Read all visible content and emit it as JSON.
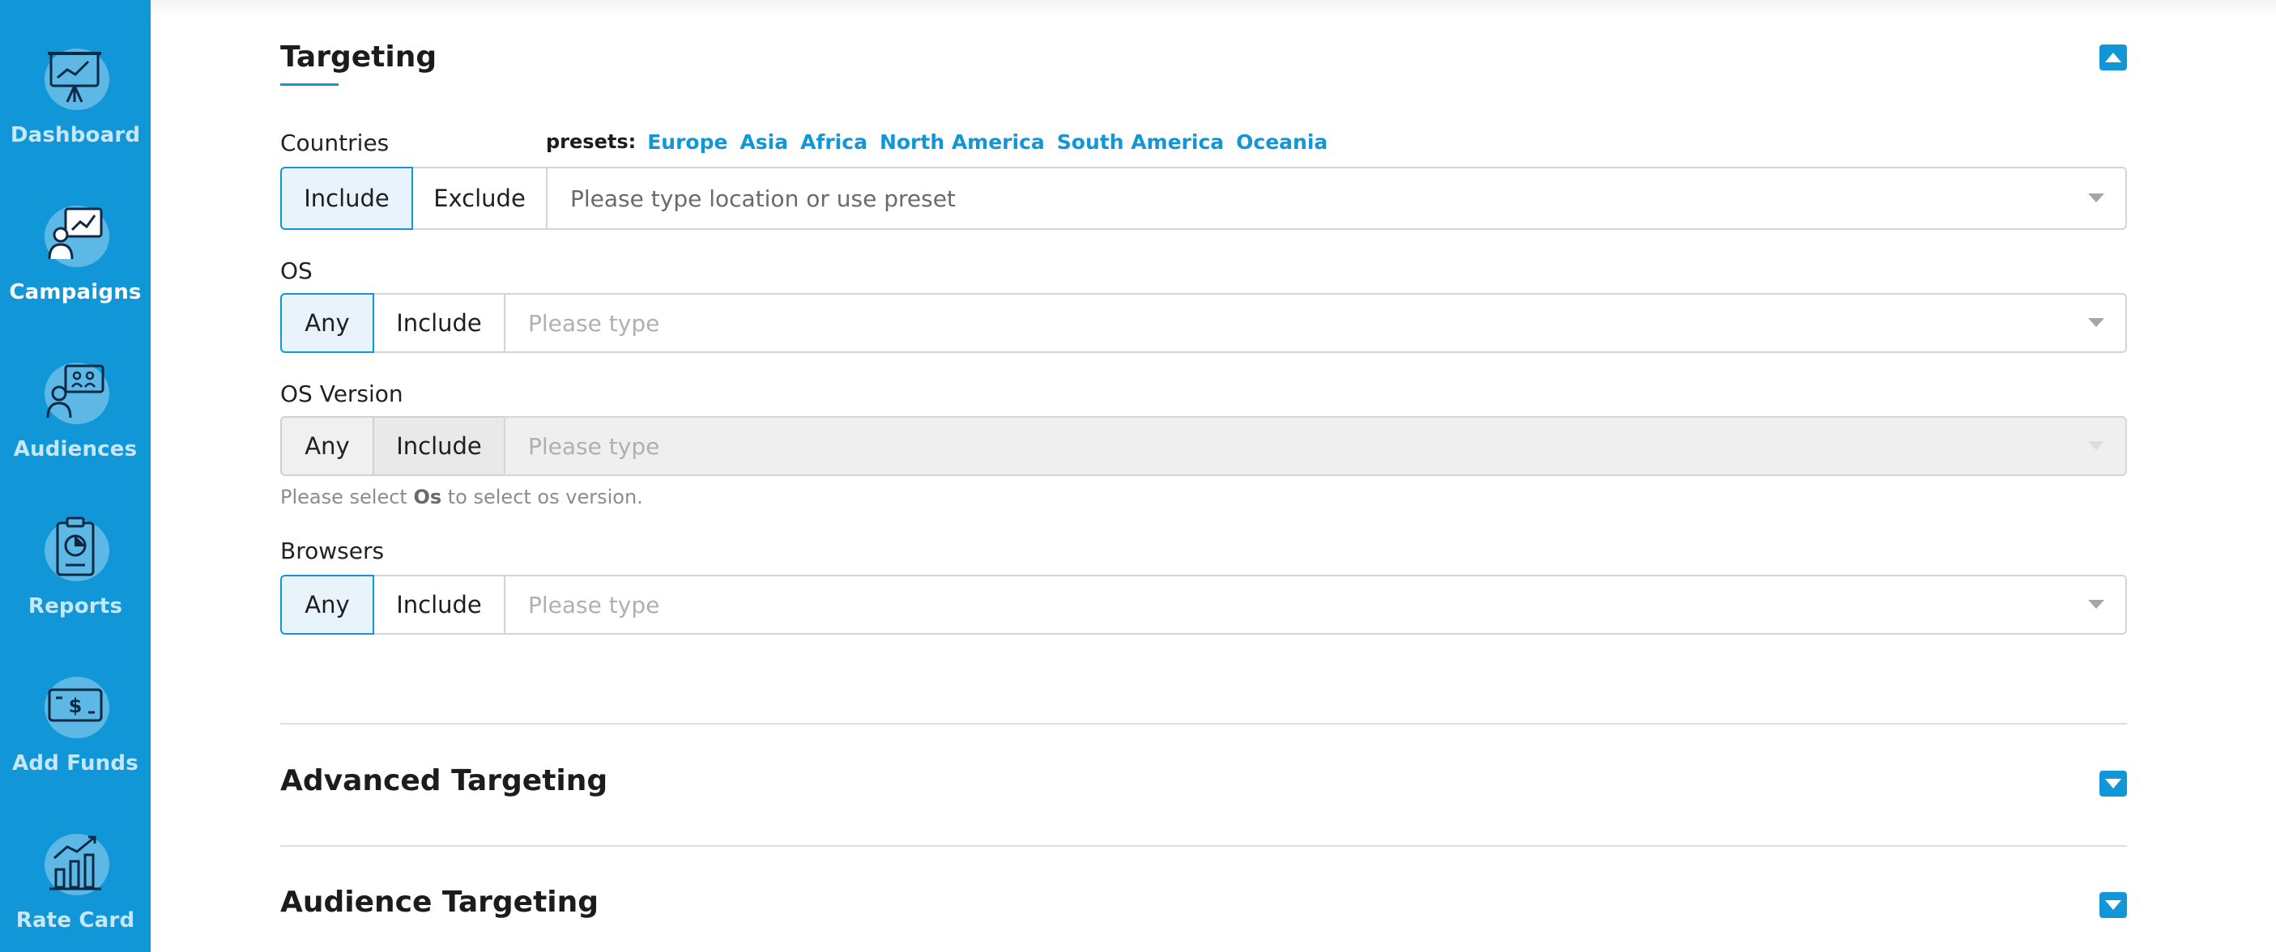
{
  "sidebar": {
    "items": [
      {
        "label": "Dashboard",
        "icon": "dashboard-chart-icon",
        "active": false
      },
      {
        "label": "Campaigns",
        "icon": "campaigns-presentation-icon",
        "active": true
      },
      {
        "label": "Audiences",
        "icon": "audiences-people-icon",
        "active": false
      },
      {
        "label": "Reports",
        "icon": "reports-clipboard-icon",
        "active": false
      },
      {
        "label": "Add Funds",
        "icon": "add-funds-bill-icon",
        "active": false
      },
      {
        "label": "Rate Card",
        "icon": "rate-card-bar-chart-icon",
        "active": false
      }
    ],
    "color": "#1197d8"
  },
  "targeting": {
    "title": "Targeting",
    "countries": {
      "label": "Countries",
      "presets_label": "presets:",
      "presets": [
        "Europe",
        "Asia",
        "Africa",
        "North America",
        "South America",
        "Oceania"
      ],
      "include_label": "Include",
      "exclude_label": "Exclude",
      "placeholder": "Please type location or use preset"
    },
    "os": {
      "label": "OS",
      "any_label": "Any",
      "include_label": "Include",
      "placeholder": "Please type"
    },
    "os_version": {
      "label": "OS Version",
      "any_label": "Any",
      "include_label": "Include",
      "placeholder": "Please type",
      "help_prefix": "Please select ",
      "help_bold": "Os",
      "help_suffix": " to select os version."
    },
    "browsers": {
      "label": "Browsers",
      "any_label": "Any",
      "include_label": "Include",
      "placeholder": "Please type"
    }
  },
  "advanced_targeting": {
    "title": "Advanced Targeting"
  },
  "audience_targeting": {
    "title": "Audience Targeting"
  },
  "accent_color": "#1197d8"
}
